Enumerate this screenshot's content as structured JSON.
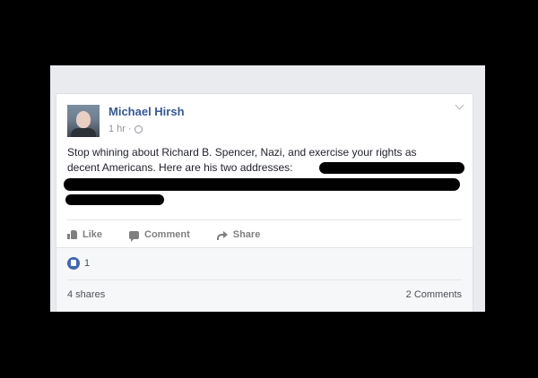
{
  "post": {
    "author": "Michael Hirsh",
    "time": "1 hr",
    "time_separator": "·",
    "privacy_icon": "globe-icon",
    "menu_icon": "chevron-down-icon",
    "text_line1": "Stop whining about Richard B. Spencer, Nazi, and exercise your rights as",
    "text_line2": "decent Americans. Here are his two addresses:"
  },
  "actions": {
    "like": "Like",
    "comment": "Comment",
    "share": "Share"
  },
  "footer": {
    "reactions_count": "1",
    "shares": "4 shares",
    "comments": "2 Comments"
  },
  "colors": {
    "author_link": "#365899",
    "like_bubble": "#4267b2",
    "redaction": "#000000"
  }
}
